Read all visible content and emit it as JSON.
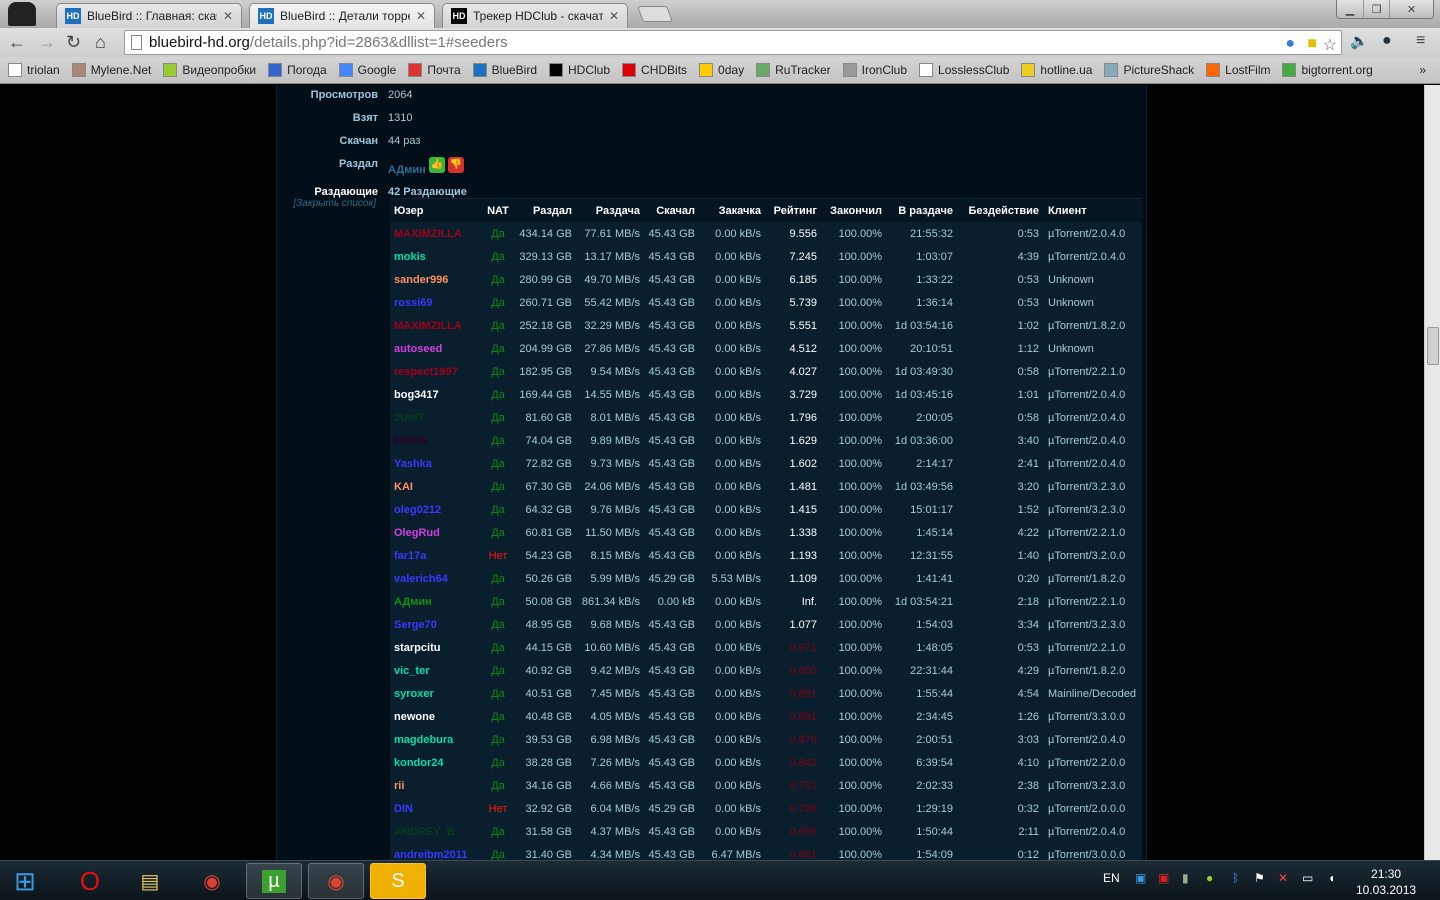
{
  "browser": {
    "tabs": [
      {
        "title": "BlueBird :: Главная: скача",
        "icon": "bluebird-icon"
      },
      {
        "title": "BlueBird :: Детали торрен",
        "icon": "bluebird-icon"
      },
      {
        "title": "Трекер HDClub - скачать",
        "icon": "hdclub-icon"
      }
    ],
    "url_host": "bluebird-hd.org",
    "url_path": "/details.php?id=2863&dllist=1#seeders",
    "bookmarks": [
      "triolan",
      "Mylene.Net",
      "Видеопробки",
      "Погода",
      "Google",
      "Почта",
      "BlueBird",
      "HDClub",
      "CHDBits",
      "0day",
      "RuTracker",
      "IronClub",
      "LosslessClub",
      "hotline.ua",
      "PictureShack",
      "LostFilm",
      "bigtorrent.org"
    ],
    "more": "»"
  },
  "info": [
    {
      "label": "Просмотров",
      "value": "2064"
    },
    {
      "label": "Взят",
      "value": "1310"
    },
    {
      "label": "Скачан",
      "value": "44 раз"
    }
  ],
  "uploader": {
    "label": "Раздал",
    "value": "АДмин"
  },
  "seeders": {
    "label": "Раздающие",
    "value": "42 Раздающие",
    "close": "[Закрыть список]"
  },
  "columns": [
    "Юзер",
    "NAT",
    "Раздал",
    "Раздача",
    "Скачал",
    "Закачка",
    "Рейтинг",
    "Закончил",
    "В раздаче",
    "Бездействие",
    "Клиент"
  ],
  "colors": {
    "red": "#a00018",
    "cyan": "#00e0a8",
    "orange": "#ff9060",
    "blue": "#3838ff",
    "magenta": "#d040e0",
    "white": "#ffffff",
    "dkgreen": "#0a3a1e",
    "dkpurple": "#2e0030",
    "green": "#109010",
    "nat_yes": "#118a11",
    "nat_no": "#ff1010",
    "low_rating": "#800012"
  },
  "rows": [
    [
      "MAXIMZILLA",
      "red",
      "Да",
      "434.14 GB",
      "77.61 MB/s",
      "45.43 GB",
      "0.00 kB/s",
      "9.556",
      "100.00%",
      "21:55:32",
      "0:53",
      "µTorrent/2.0.4.0"
    ],
    [
      "mokis",
      "cyan",
      "Да",
      "329.13 GB",
      "13.17 MB/s",
      "45.43 GB",
      "0.00 kB/s",
      "7.245",
      "100.00%",
      "1:03:07",
      "4:39",
      "µTorrent/2.0.4.0"
    ],
    [
      "sander996",
      "orange",
      "Да",
      "280.99 GB",
      "49.70 MB/s",
      "45.43 GB",
      "0.00 kB/s",
      "6.185",
      "100.00%",
      "1:33:22",
      "0:53",
      "Unknown"
    ],
    [
      "rossi69",
      "blue",
      "Да",
      "260.71 GB",
      "55.42 MB/s",
      "45.43 GB",
      "0.00 kB/s",
      "5.739",
      "100.00%",
      "1:36:14",
      "0:53",
      "Unknown"
    ],
    [
      "MAXIMZILLA",
      "red",
      "Да",
      "252.18 GB",
      "32.29 MB/s",
      "45.43 GB",
      "0.00 kB/s",
      "5.551",
      "100.00%",
      "1d 03:54:16",
      "1:02",
      "µTorrent/1.8.2.0"
    ],
    [
      "autoseed",
      "magenta",
      "Да",
      "204.99 GB",
      "27.86 MB/s",
      "45.43 GB",
      "0.00 kB/s",
      "4.512",
      "100.00%",
      "20:10:51",
      "1:12",
      "Unknown"
    ],
    [
      "respect1997",
      "red",
      "Да",
      "182.95 GB",
      "9.54 MB/s",
      "45.43 GB",
      "0.00 kB/s",
      "4.027",
      "100.00%",
      "1d 03:49:30",
      "0:58",
      "µTorrent/2.2.1.0"
    ],
    [
      "bog3417",
      "white",
      "Да",
      "169.44 GB",
      "14.55 MB/s",
      "45.43 GB",
      "0.00 kB/s",
      "3.729",
      "100.00%",
      "1d 03:45:16",
      "1:01",
      "µTorrent/2.0.4.0"
    ],
    [
      "2UniT",
      "dkgreen",
      "Да",
      "81.60 GB",
      "8.01 MB/s",
      "45.43 GB",
      "0.00 kB/s",
      "1.796",
      "100.00%",
      "2:00:05",
      "0:58",
      "µTorrent/2.0.4.0"
    ],
    [
      "FiRON",
      "dkpurple",
      "Да",
      "74.04 GB",
      "9.89 MB/s",
      "45.43 GB",
      "0.00 kB/s",
      "1.629",
      "100.00%",
      "1d 03:36:00",
      "3:40",
      "µTorrent/2.0.4.0"
    ],
    [
      "Yashka",
      "blue",
      "Да",
      "72.82 GB",
      "9.73 MB/s",
      "45.43 GB",
      "0.00 kB/s",
      "1.602",
      "100.00%",
      "2:14:17",
      "2:41",
      "µTorrent/2.0.4.0"
    ],
    [
      "KAI",
      "orange",
      "Да",
      "67.30 GB",
      "24.06 MB/s",
      "45.43 GB",
      "0.00 kB/s",
      "1.481",
      "100.00%",
      "1d 03:49:56",
      "3:20",
      "µTorrent/3.2.3.0"
    ],
    [
      "oleg0212",
      "blue",
      "Да",
      "64.32 GB",
      "9.76 MB/s",
      "45.43 GB",
      "0.00 kB/s",
      "1.415",
      "100.00%",
      "15:01:17",
      "1:52",
      "µTorrent/3.2.3.0"
    ],
    [
      "OlegRud",
      "magenta",
      "Да",
      "60.81 GB",
      "11.50 MB/s",
      "45.43 GB",
      "0.00 kB/s",
      "1.338",
      "100.00%",
      "1:45:14",
      "4:22",
      "µTorrent/2.2.1.0"
    ],
    [
      "far17a",
      "blue",
      "Нет",
      "54.23 GB",
      "8.15 MB/s",
      "45.43 GB",
      "0.00 kB/s",
      "1.193",
      "100.00%",
      "12:31:55",
      "1:40",
      "µTorrent/3.2.0.0"
    ],
    [
      "valerich64",
      "blue",
      "Да",
      "50.26 GB",
      "5.99 MB/s",
      "45.29 GB",
      "5.53 MB/s",
      "1.109",
      "100.00%",
      "1:41:41",
      "0:20",
      "µTorrent/1.8.2.0"
    ],
    [
      "АДмин",
      "green",
      "Да",
      "50.08 GB",
      "861.34 kB/s",
      "0.00 kB",
      "0.00 kB/s",
      "Inf.",
      "100.00%",
      "1d 03:54:21",
      "2:18",
      "µTorrent/2.2.1.0"
    ],
    [
      "Serge70",
      "blue",
      "Да",
      "48.95 GB",
      "9.68 MB/s",
      "45.43 GB",
      "0.00 kB/s",
      "1.077",
      "100.00%",
      "1:54:03",
      "3:34",
      "µTorrent/3.2.3.0"
    ],
    [
      "starpcitu",
      "white",
      "Да",
      "44.15 GB",
      "10.60 MB/s",
      "45.43 GB",
      "0.00 kB/s",
      "0.971",
      "100.00%",
      "1:48:05",
      "0:53",
      "µTorrent/2.2.1.0"
    ],
    [
      "vic_ter",
      "cyan",
      "Да",
      "40.92 GB",
      "9.42 MB/s",
      "45.43 GB",
      "0.00 kB/s",
      "0.900",
      "100.00%",
      "22:31:44",
      "4:29",
      "µTorrent/1.8.2.0"
    ],
    [
      "syroxer",
      "cyan",
      "Да",
      "40.51 GB",
      "7.45 MB/s",
      "45.43 GB",
      "0.00 kB/s",
      "0.891",
      "100.00%",
      "1:55:44",
      "4:54",
      "Mainline/Decoded"
    ],
    [
      "newone",
      "white",
      "Да",
      "40.48 GB",
      "4.05 MB/s",
      "45.43 GB",
      "0.00 kB/s",
      "0.891",
      "100.00%",
      "2:34:45",
      "1:26",
      "µTorrent/3.3.0.0"
    ],
    [
      "magdebura",
      "cyan",
      "Да",
      "39.53 GB",
      "6.98 MB/s",
      "45.43 GB",
      "0.00 kB/s",
      "0.870",
      "100.00%",
      "2:00:51",
      "3:03",
      "µTorrent/2.0.4.0"
    ],
    [
      "kondor24",
      "cyan",
      "Да",
      "38.28 GB",
      "7.26 MB/s",
      "45.43 GB",
      "0.00 kB/s",
      "0.842",
      "100.00%",
      "6:39:54",
      "4:10",
      "µTorrent/2.2.0.0"
    ],
    [
      "rii",
      "orange",
      "Да",
      "34.16 GB",
      "4.66 MB/s",
      "45.43 GB",
      "0.00 kB/s",
      "0.751",
      "100.00%",
      "2:02:33",
      "2:38",
      "µTorrent/3.2.3.0"
    ],
    [
      "DIN",
      "blue",
      "Нет",
      "32.92 GB",
      "6.04 MB/s",
      "45.29 GB",
      "0.00 kB/s",
      "0.726",
      "100.00%",
      "1:29:19",
      "0:32",
      "µTorrent/2.0.0.0"
    ],
    [
      "ANDREY_B",
      "dkgreen",
      "Да",
      "31.58 GB",
      "4.37 MB/s",
      "45.43 GB",
      "0.00 kB/s",
      "0.695",
      "100.00%",
      "1:50:44",
      "2:11",
      "µTorrent/2.0.4.0"
    ],
    [
      "andreibm2011",
      "blue",
      "Да",
      "31.40 GB",
      "4.34 MB/s",
      "45.43 GB",
      "6.47 MB/s",
      "0.691",
      "100.00%",
      "1:54:09",
      "0:12",
      "µTorrent/3.0.0.0"
    ]
  ],
  "taskbar": {
    "lang": "EN",
    "time": "21:30",
    "date": "10.03.2013"
  }
}
